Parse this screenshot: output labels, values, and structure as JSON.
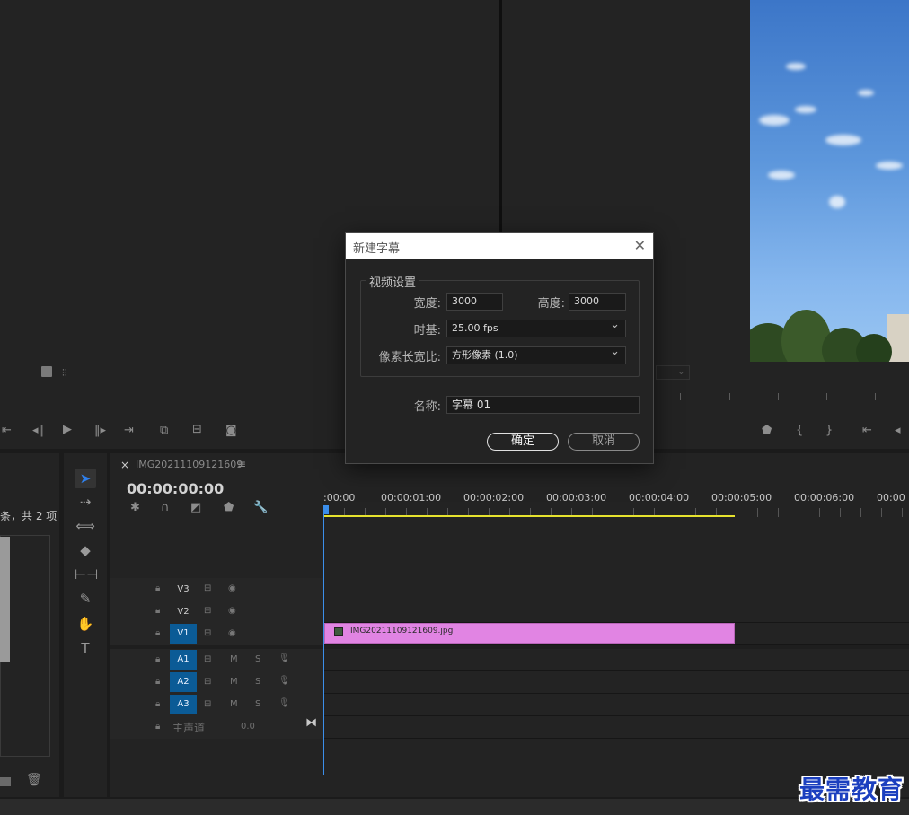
{
  "project": {
    "item_count": "条，共 2 项"
  },
  "timeline": {
    "close": "×",
    "sequence_name": "IMG20211109121609",
    "menu": "≡",
    "timecode": "00:00:00:00",
    "ruler_labels": [
      ":00:00",
      "00:00:01:00",
      "00:00:02:00",
      "00:00:03:00",
      "00:00:04:00",
      "00:00:05:00",
      "00:00:06:00",
      "00:00"
    ],
    "tracks": {
      "v3": "V3",
      "v2": "V2",
      "v1": "V1",
      "a1": "A1",
      "a2": "A2",
      "a3": "A3",
      "master": "主声道",
      "master_value": "0.0",
      "mute": "M",
      "solo": "S"
    },
    "clip": {
      "name": "IMG20211109121609.jpg",
      "color": "#e184e3"
    }
  },
  "dialog": {
    "title": "新建字幕",
    "close": "✕",
    "group_title": "视频设置",
    "width_label": "宽度:",
    "width_value": "3000",
    "height_label": "高度:",
    "height_value": "3000",
    "timebase_label": "时基:",
    "timebase_value": "25.00 fps",
    "par_label": "像素长宽比:",
    "par_value": "方形像素 (1.0)",
    "name_label": "名称:",
    "name_value": "字幕 01",
    "ok": "确定",
    "cancel": "取消"
  },
  "watermark": "最需教育",
  "colors": {
    "accent": "#2f80ed",
    "track_on": "#0b5b96",
    "work_area": "#e6e22e",
    "playhead": "#3b8eea"
  }
}
